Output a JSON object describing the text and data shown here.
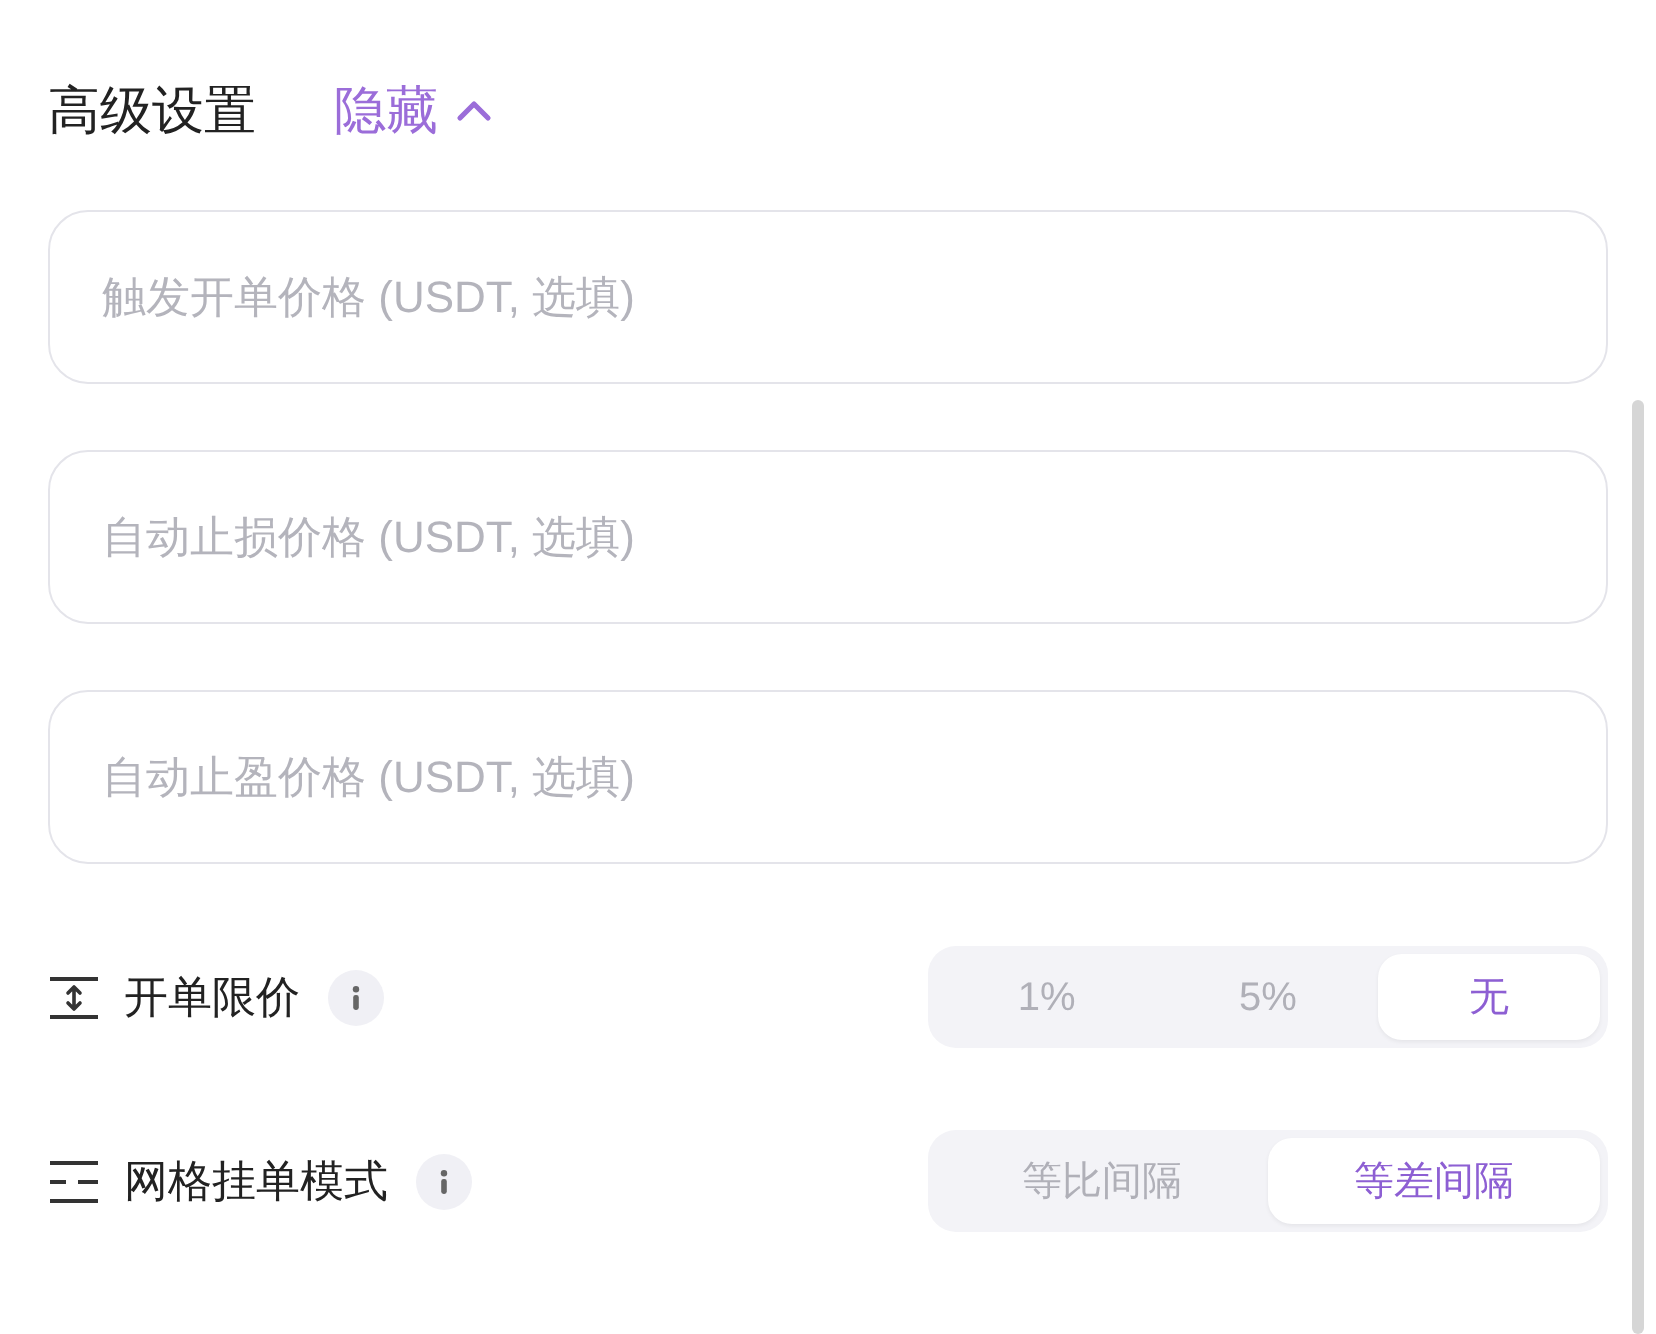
{
  "header": {
    "title": "高级设置",
    "toggle": {
      "label": "隐藏",
      "expanded": true
    }
  },
  "fields": [
    {
      "placeholder": "触发开单价格 (USDT, 选填)"
    },
    {
      "placeholder": "自动止损价格 (USDT, 选填)"
    },
    {
      "placeholder": "自动止盈价格 (USDT, 选填)"
    }
  ],
  "settings": [
    {
      "kind": "limit",
      "label": "开单限价",
      "options": [
        {
          "label": "1%",
          "selected": false
        },
        {
          "label": "5%",
          "selected": false
        },
        {
          "label": "无",
          "selected": true
        }
      ]
    },
    {
      "kind": "grid",
      "label": "网格挂单模式",
      "options": [
        {
          "label": "等比间隔",
          "selected": false
        },
        {
          "label": "等差间隔",
          "selected": true
        }
      ]
    }
  ]
}
